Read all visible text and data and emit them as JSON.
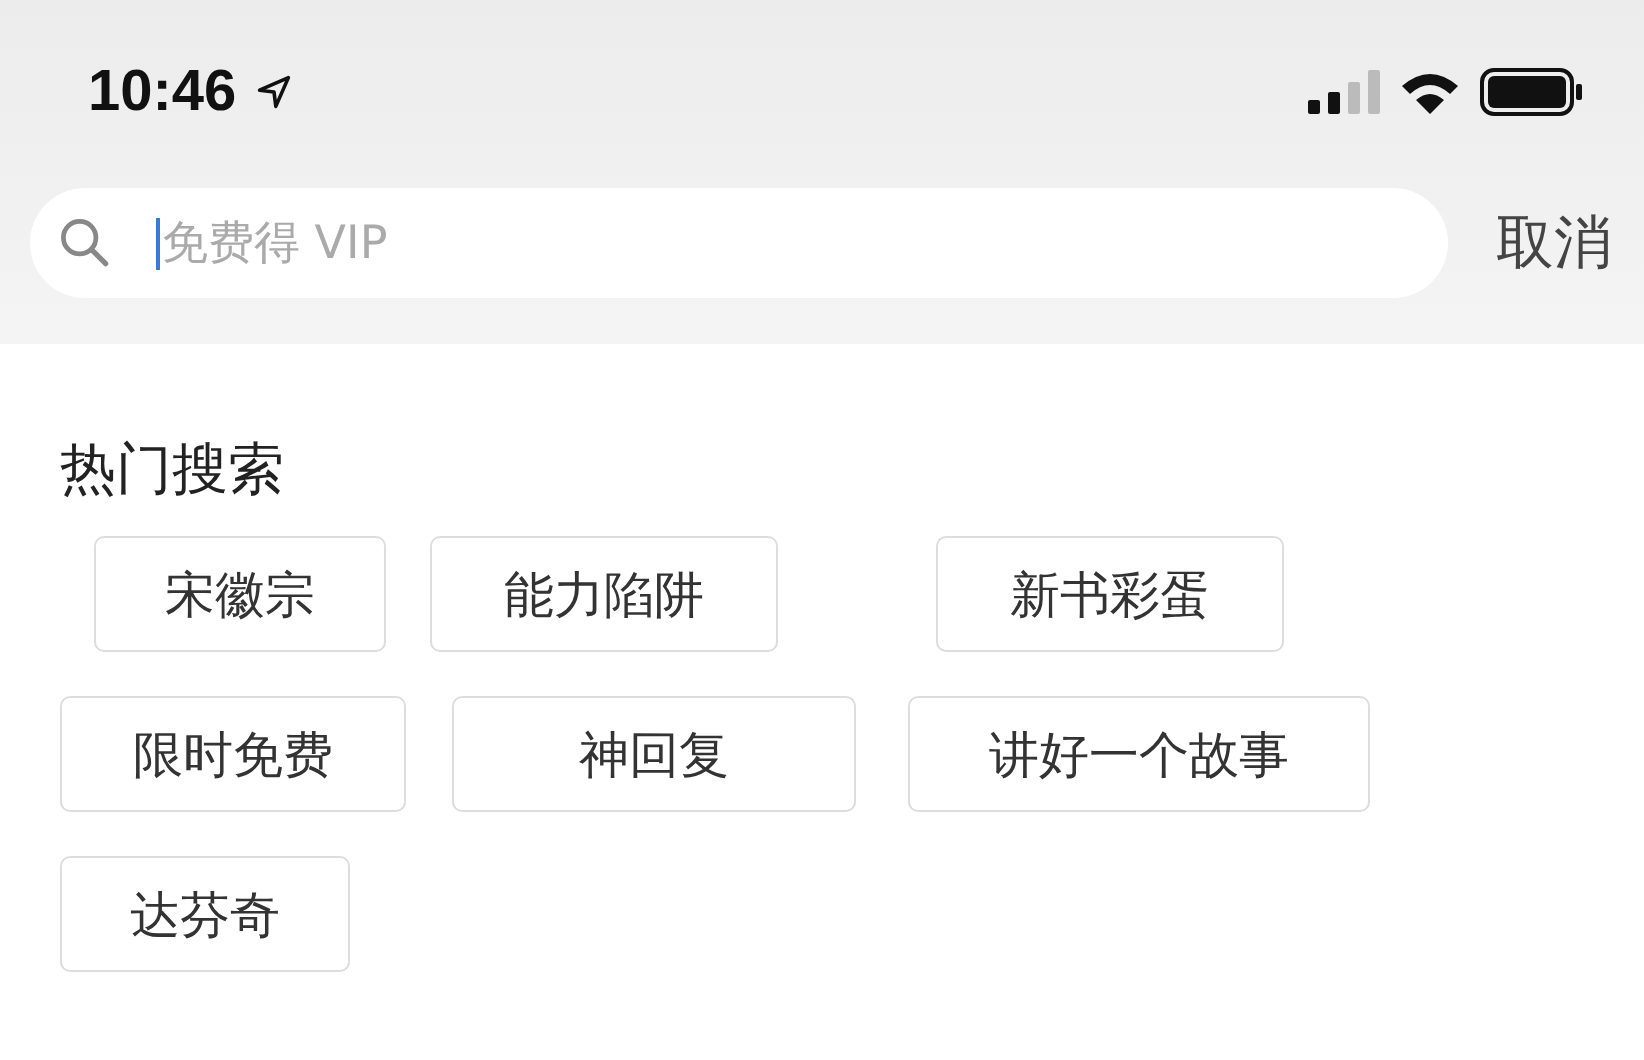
{
  "status_bar": {
    "time": "10:46"
  },
  "search": {
    "placeholder": "免费得 VIP",
    "cancel": "取消"
  },
  "hot": {
    "title": "热门搜索",
    "rows": [
      {
        "tags": [
          "宋徽宗",
          "能力陷阱",
          "新书彩蛋"
        ]
      },
      {
        "tags": [
          "限时免费",
          "神回复",
          "讲好一个故事"
        ]
      },
      {
        "tags": [
          "达芬奇"
        ]
      }
    ]
  }
}
